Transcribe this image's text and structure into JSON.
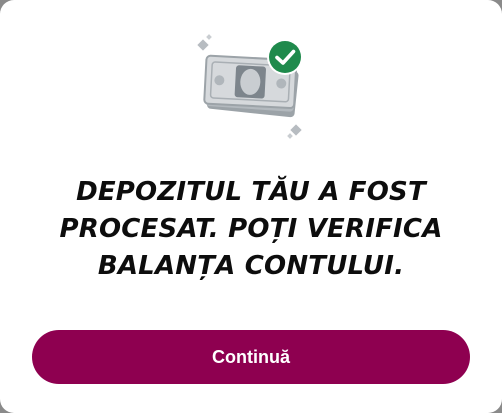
{
  "dialog": {
    "message": "Depozitul tău a fost procesat. Poți verifica balanța contului.",
    "continue_label": "Continuă"
  },
  "icons": {
    "illustration": "cash-stack-with-checkmark-icon",
    "badge": "checkmark-icon"
  },
  "colors": {
    "accent": "#8e0050",
    "success": "#1f8a4c",
    "bill_dark": "#9ca3a8",
    "bill_light": "#c9cdd1"
  }
}
